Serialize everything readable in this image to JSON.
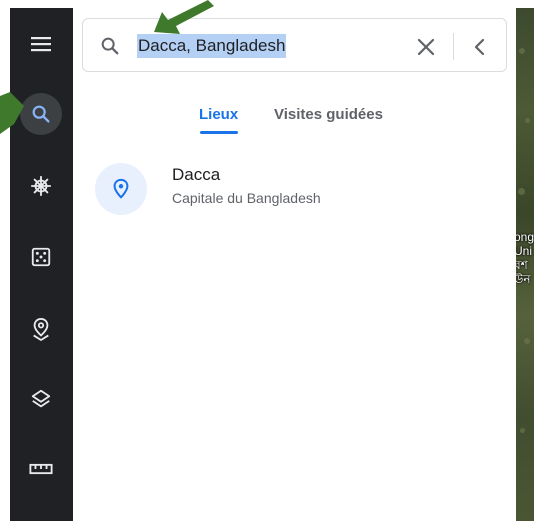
{
  "search": {
    "query": "Dacca, Bangladesh"
  },
  "tabs": [
    {
      "label": "Lieux",
      "active": true
    },
    {
      "label": "Visites guidées",
      "active": false
    }
  ],
  "results": [
    {
      "title": "Dacca",
      "subtitle": "Capitale du Bangladesh"
    }
  ],
  "sidebar": {
    "items": [
      {
        "icon": "menu-icon"
      },
      {
        "icon": "search-icon",
        "active": true
      },
      {
        "icon": "voyager-wheel-icon"
      },
      {
        "icon": "dice-icon"
      },
      {
        "icon": "projects-pin-icon"
      },
      {
        "icon": "layers-icon"
      },
      {
        "icon": "ruler-icon"
      }
    ]
  },
  "map": {
    "edge_label": "ong\nUni\nবশ\nউন"
  },
  "colors": {
    "accent": "#1a73e8",
    "rail": "#202124",
    "selection": "#b4d1f5",
    "annotation_arrow": "#3f7a2c"
  }
}
